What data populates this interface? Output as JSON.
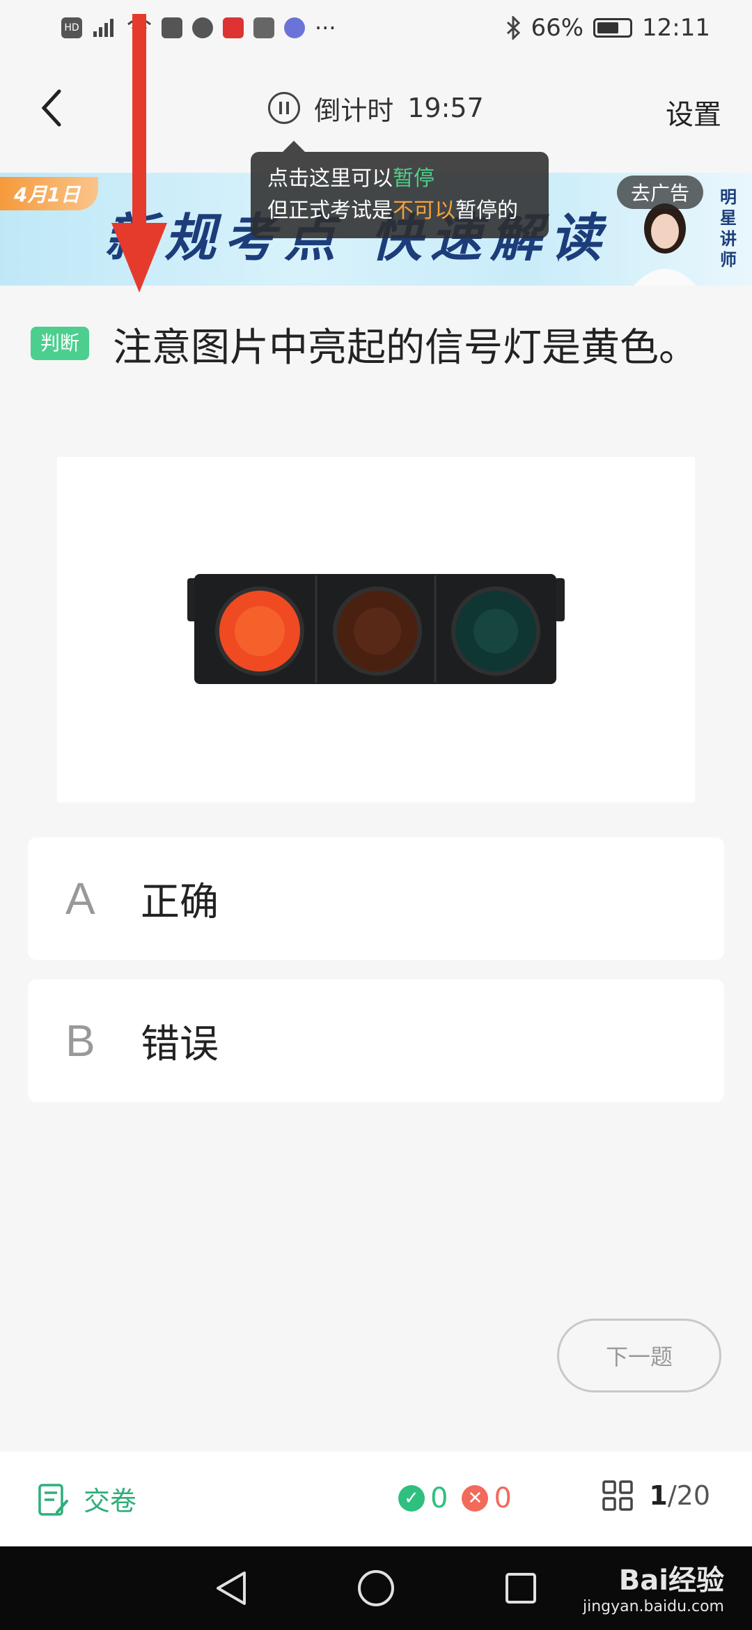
{
  "status_bar": {
    "left_text": "HD 4G",
    "more": "···",
    "battery": "66%",
    "time": "12:11"
  },
  "header": {
    "timer_label": "倒计时",
    "timer_value": "19:57",
    "settings_label": "设置"
  },
  "tooltip": {
    "line1_prefix": "点击这里可以",
    "line1_highlight": "暂停",
    "line2_prefix": "但正式考试是",
    "line2_highlight": "不可以",
    "line2_suffix": "暂停的"
  },
  "banner": {
    "date": "4月1日",
    "title": "新规考点 快速解读",
    "ad_label": "去广告",
    "side_text_1": "明",
    "side_text_2": "星",
    "side_text_3": "讲",
    "side_text_4": "师"
  },
  "question": {
    "type": "判断",
    "text": "注意图片中亮起的信号灯是黄色。",
    "image": {
      "description_icon": "traffic-light",
      "lit_light": "red"
    }
  },
  "options": [
    {
      "letter": "A",
      "text": "正确"
    },
    {
      "letter": "B",
      "text": "错误"
    }
  ],
  "next_button": "下一题",
  "bottom_bar": {
    "submit_label": "交卷",
    "correct_count": "0",
    "wrong_count": "0",
    "current": "1",
    "total": "/20"
  },
  "watermark": {
    "brand": "Bai经验",
    "url": "jingyan.baidu.com"
  },
  "colors": {
    "accent_green": "#2fae7a",
    "badge_green": "#4ccf8e",
    "wrong_red": "#f26a5a",
    "tooltip_highlight_orange": "#f5a23c"
  }
}
